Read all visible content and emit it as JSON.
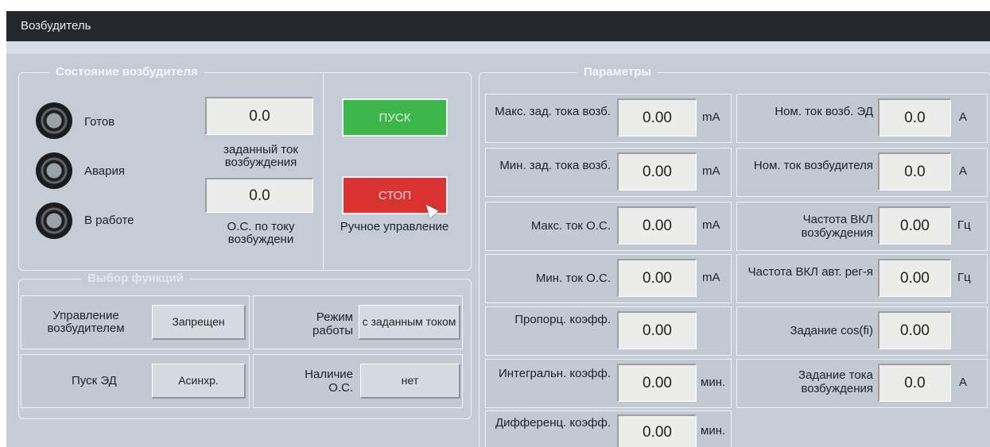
{
  "window": {
    "title": "Возбудитель"
  },
  "state": {
    "legend": "Состояние возбудителя",
    "indicators": [
      {
        "label": "Готов"
      },
      {
        "label": "Авария"
      },
      {
        "label": "В работе"
      }
    ],
    "set_current": {
      "value": "0.0",
      "caption": "заданный ток возбуждения"
    },
    "fb_current": {
      "value": "0.0",
      "caption": "О.С. по току возбуждени"
    },
    "start_label": "ПУСК",
    "stop_label": "СТОП",
    "manual_caption": "Ручное управление"
  },
  "functions": {
    "legend": "Выбор функций",
    "items": [
      {
        "label": "Управление возбудителем",
        "value": "Запрещен"
      },
      {
        "label": "Режим работы",
        "value": "с заданным током"
      },
      {
        "label": "Пуск ЭД",
        "value": "Асинхр."
      },
      {
        "label": "Наличие О.С.",
        "value": "нет"
      }
    ]
  },
  "params": {
    "legend": "Параметры",
    "left": [
      {
        "label": "Макс. зад. тока возб.",
        "value": "0.00",
        "unit": "mA"
      },
      {
        "label": "Мин. зад. тока возб.",
        "value": "0.00",
        "unit": "mA"
      },
      {
        "label": "Макс. ток О.С.",
        "value": "0.00",
        "unit": "mA"
      },
      {
        "label": "Мин. ток О.С.",
        "value": "0.00",
        "unit": "mA"
      },
      {
        "label": "Пропорц. коэфф.",
        "value": "0.00",
        "unit": ""
      },
      {
        "label": "Интегральн. коэфф.",
        "value": "0.00",
        "unit": "мин."
      },
      {
        "label": "Дифференц. коэфф.",
        "value": "0.00",
        "unit": "мин."
      }
    ],
    "right": [
      {
        "label": "Ном. ток возб. ЭД",
        "value": "0.0",
        "unit": "А"
      },
      {
        "label": "Ном. ток возбудителя",
        "value": "0.0",
        "unit": "А"
      },
      {
        "label": "Частота ВКЛ возбуждения",
        "value": "0.00",
        "unit": "Гц"
      },
      {
        "label": "Частота ВКЛ авт. рег-я",
        "value": "0.00",
        "unit": "Гц"
      },
      {
        "label": "Задание cos(fi)",
        "value": "0.00",
        "unit": ""
      },
      {
        "label": "Задание тока возбуждения",
        "value": "0.0",
        "unit": "А"
      }
    ]
  }
}
